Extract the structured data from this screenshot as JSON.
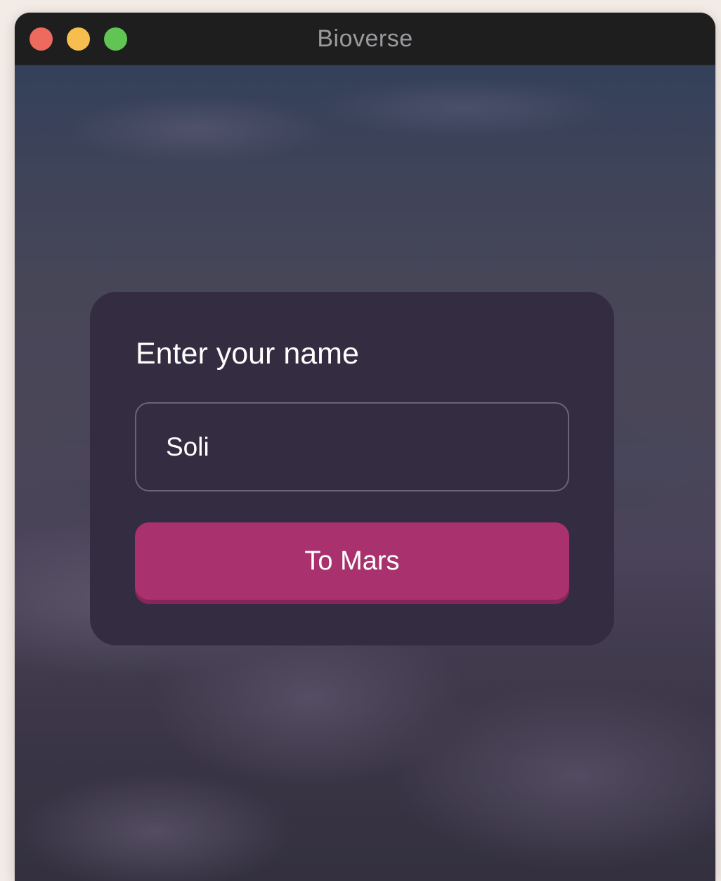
{
  "window": {
    "title": "Bioverse",
    "controls": [
      "close",
      "minimize",
      "zoom"
    ]
  },
  "form": {
    "heading": "Enter your name",
    "name_value": "Soli",
    "submit_label": "To Mars"
  },
  "colors": {
    "card_background": "#342d41",
    "button_background": "#a9316d",
    "input_border": "#6b6478",
    "titlebar_background": "#1e1e1f",
    "close": "#ee6a5e",
    "minimize": "#f5be4f",
    "zoom": "#61c554"
  }
}
